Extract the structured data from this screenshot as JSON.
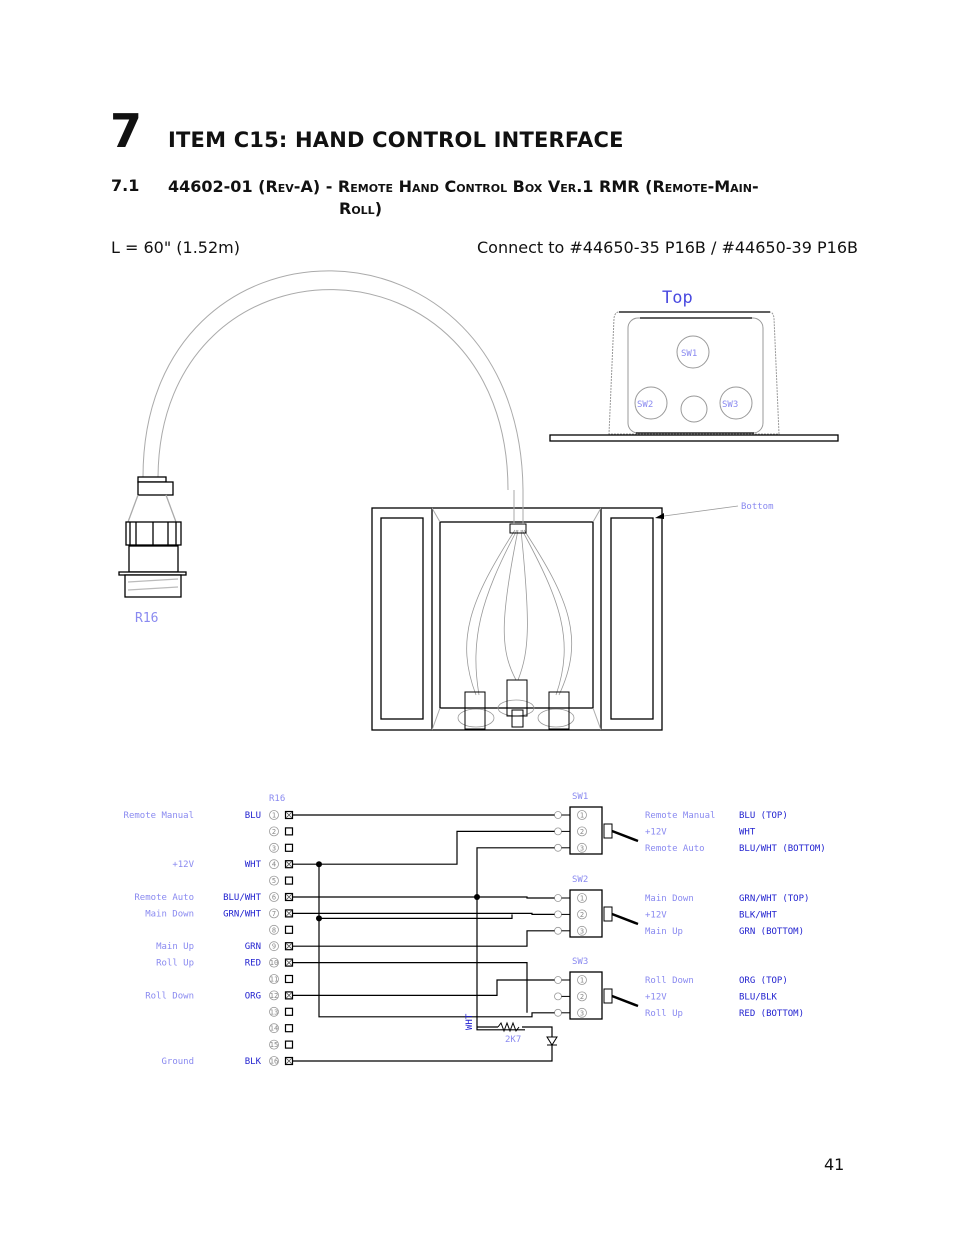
{
  "header": {
    "chapter_number": "7",
    "chapter_title": "ITEM C15: HAND CONTROL INTERFACE",
    "section_number": "7.1",
    "section_title_line1": "44602-01 (Rev-A) - Remote Hand Control Box Ver.1 RMR (Remote-Main-",
    "section_title_line2": "Roll)",
    "length_spec": "L = 60\" (1.52m)",
    "connect_to": "Connect to #44650-35 P16B / #44650-39 P16B"
  },
  "drawing": {
    "top_view_label": "Top",
    "bottom_view_label": "Bottom",
    "connector_label": "R16",
    "top_view_switches": [
      "SW1",
      "SW2",
      "SW3"
    ]
  },
  "schematic": {
    "connector_title": "R16",
    "connector_pins": [
      {
        "pin": "1",
        "function": "Remote Manual",
        "wire": "BLU",
        "connected": true
      },
      {
        "pin": "2",
        "function": "",
        "wire": "",
        "connected": false
      },
      {
        "pin": "3",
        "function": "",
        "wire": "",
        "connected": false
      },
      {
        "pin": "4",
        "function": "+12V",
        "wire": "WHT",
        "connected": true
      },
      {
        "pin": "5",
        "function": "",
        "wire": "",
        "connected": false
      },
      {
        "pin": "6",
        "function": "Remote Auto",
        "wire": "BLU/WHT",
        "connected": true
      },
      {
        "pin": "7",
        "function": "Main Down",
        "wire": "GRN/WHT",
        "connected": true
      },
      {
        "pin": "8",
        "function": "",
        "wire": "",
        "connected": false
      },
      {
        "pin": "9",
        "function": "Main Up",
        "wire": "GRN",
        "connected": true
      },
      {
        "pin": "10",
        "function": "Roll Up",
        "wire": "RED",
        "connected": true
      },
      {
        "pin": "11",
        "function": "",
        "wire": "",
        "connected": false
      },
      {
        "pin": "12",
        "function": "Roll Down",
        "wire": "ORG",
        "connected": true
      },
      {
        "pin": "13",
        "function": "",
        "wire": "",
        "connected": false
      },
      {
        "pin": "14",
        "function": "",
        "wire": "",
        "connected": false
      },
      {
        "pin": "15",
        "function": "",
        "wire": "",
        "connected": false
      },
      {
        "pin": "16",
        "function": "Ground",
        "wire": "BLK",
        "connected": true
      }
    ],
    "switches": [
      {
        "name": "SW1",
        "pins": [
          {
            "pin": "1",
            "function": "Remote Manual",
            "wire": "BLU (TOP)"
          },
          {
            "pin": "2",
            "function": "+12V",
            "wire": "WHT"
          },
          {
            "pin": "3",
            "function": "Remote Auto",
            "wire": "BLU/WHT (BOTTOM)"
          }
        ]
      },
      {
        "name": "SW2",
        "pins": [
          {
            "pin": "1",
            "function": "Main Down",
            "wire": "GRN/WHT (TOP)"
          },
          {
            "pin": "2",
            "function": "+12V",
            "wire": "BLK/WHT"
          },
          {
            "pin": "3",
            "function": "Main Up",
            "wire": "GRN (BOTTOM)"
          }
        ]
      },
      {
        "name": "SW3",
        "pins": [
          {
            "pin": "1",
            "function": "Roll Down",
            "wire": "ORG (TOP)"
          },
          {
            "pin": "2",
            "function": "+12V",
            "wire": "BLU/BLK"
          },
          {
            "pin": "3",
            "function": "Roll Up",
            "wire": "RED (BOTTOM)"
          }
        ]
      }
    ],
    "led_wire_label": "WHT",
    "resistor_label": "2K7"
  },
  "footer": {
    "page_number": "41"
  }
}
